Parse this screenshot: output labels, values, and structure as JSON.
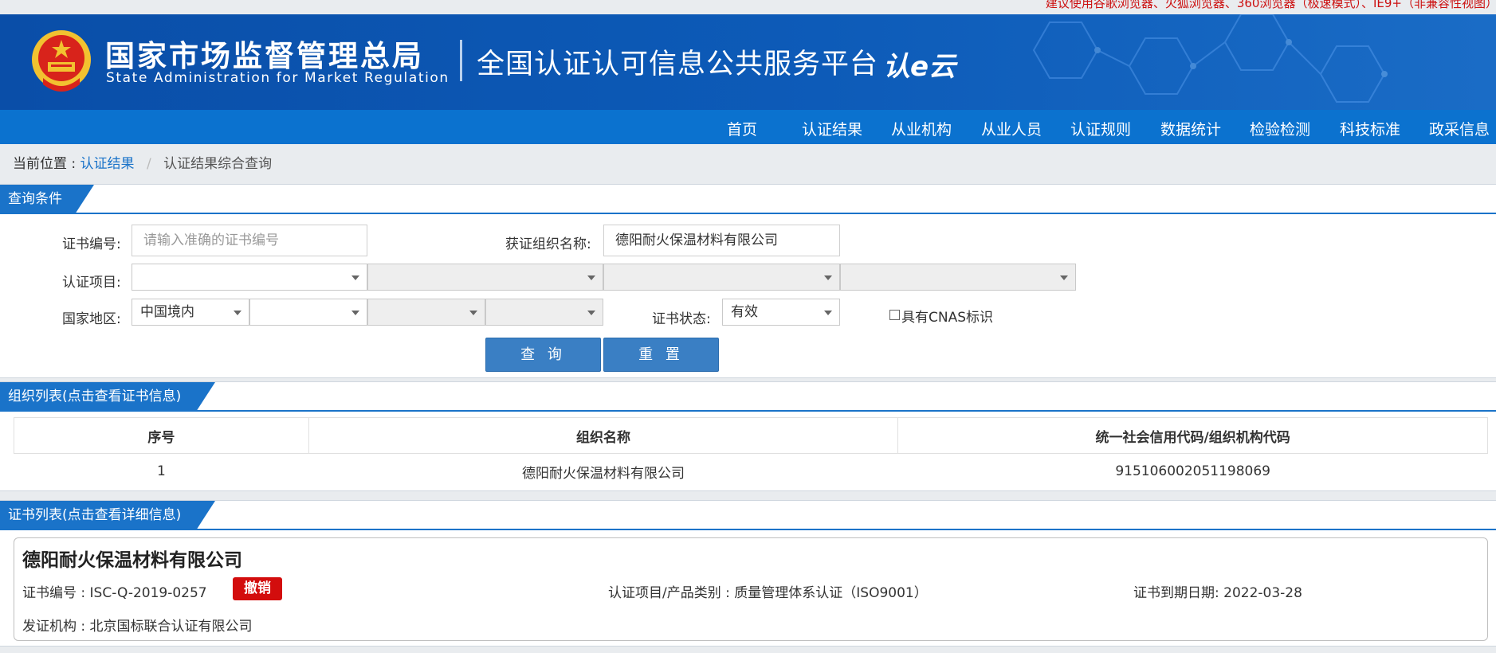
{
  "notice": "建议使用谷歌浏览器、火狐浏览器、360浏览器（极速模式）、IE9+（非兼容性视图）",
  "header": {
    "org_cn": "国家市场监督管理总局",
    "org_en": "State Administration for Market Regulation",
    "platform": "全国认证认可信息公共服务平台",
    "brand": "认e云"
  },
  "nav": [
    "首页",
    "认证结果",
    "从业机构",
    "从业人员",
    "认证规则",
    "数据统计",
    "检验检测",
    "科技标准",
    "政采信息"
  ],
  "breadcrumb": {
    "prefix": "当前位置 :",
    "link": "认证结果",
    "separator": "/",
    "current": "认证结果综合查询"
  },
  "query": {
    "section_title": "查询条件",
    "cert_no_label": "证书编号:",
    "cert_no_placeholder": "请输入准确的证书编号",
    "org_name_label": "获证组织名称:",
    "org_name_value": "德阳耐火保温材料有限公司",
    "project_label": "认证项目:",
    "region_label": "国家地区:",
    "region_value": "中国境内",
    "status_label": "证书状态:",
    "status_value": "有效",
    "cnas_label": "具有CNAS标识",
    "search_button": "查 询",
    "reset_button": "重 置"
  },
  "org_list": {
    "section_title": "组织列表(点击查看证书信息)",
    "headers": [
      "序号",
      "组织名称",
      "统一社会信用代码/组织机构代码"
    ],
    "rows": [
      {
        "index": "1",
        "name": "德阳耐火保温材料有限公司",
        "code": "915106002051198069"
      }
    ]
  },
  "cert_list": {
    "section_title": "证书列表(点击查看详细信息)",
    "items": [
      {
        "org_name": "德阳耐火保温材料有限公司",
        "cert_no": "证书编号 : ISC-Q-2019-0257",
        "status_badge": "撤销",
        "project": "认证项目/产品类别 : 质量管理体系认证（ISO9001）",
        "expiry": "证书到期日期: 2022-03-28",
        "issuer": "发证机构 : 北京国标联合认证有限公司"
      }
    ]
  },
  "colors": {
    "brand_blue": "#0a4ea8",
    "nav_blue": "#0b72cf",
    "accent_blue": "#1a73c9",
    "revoked_red": "#d30d0d"
  }
}
